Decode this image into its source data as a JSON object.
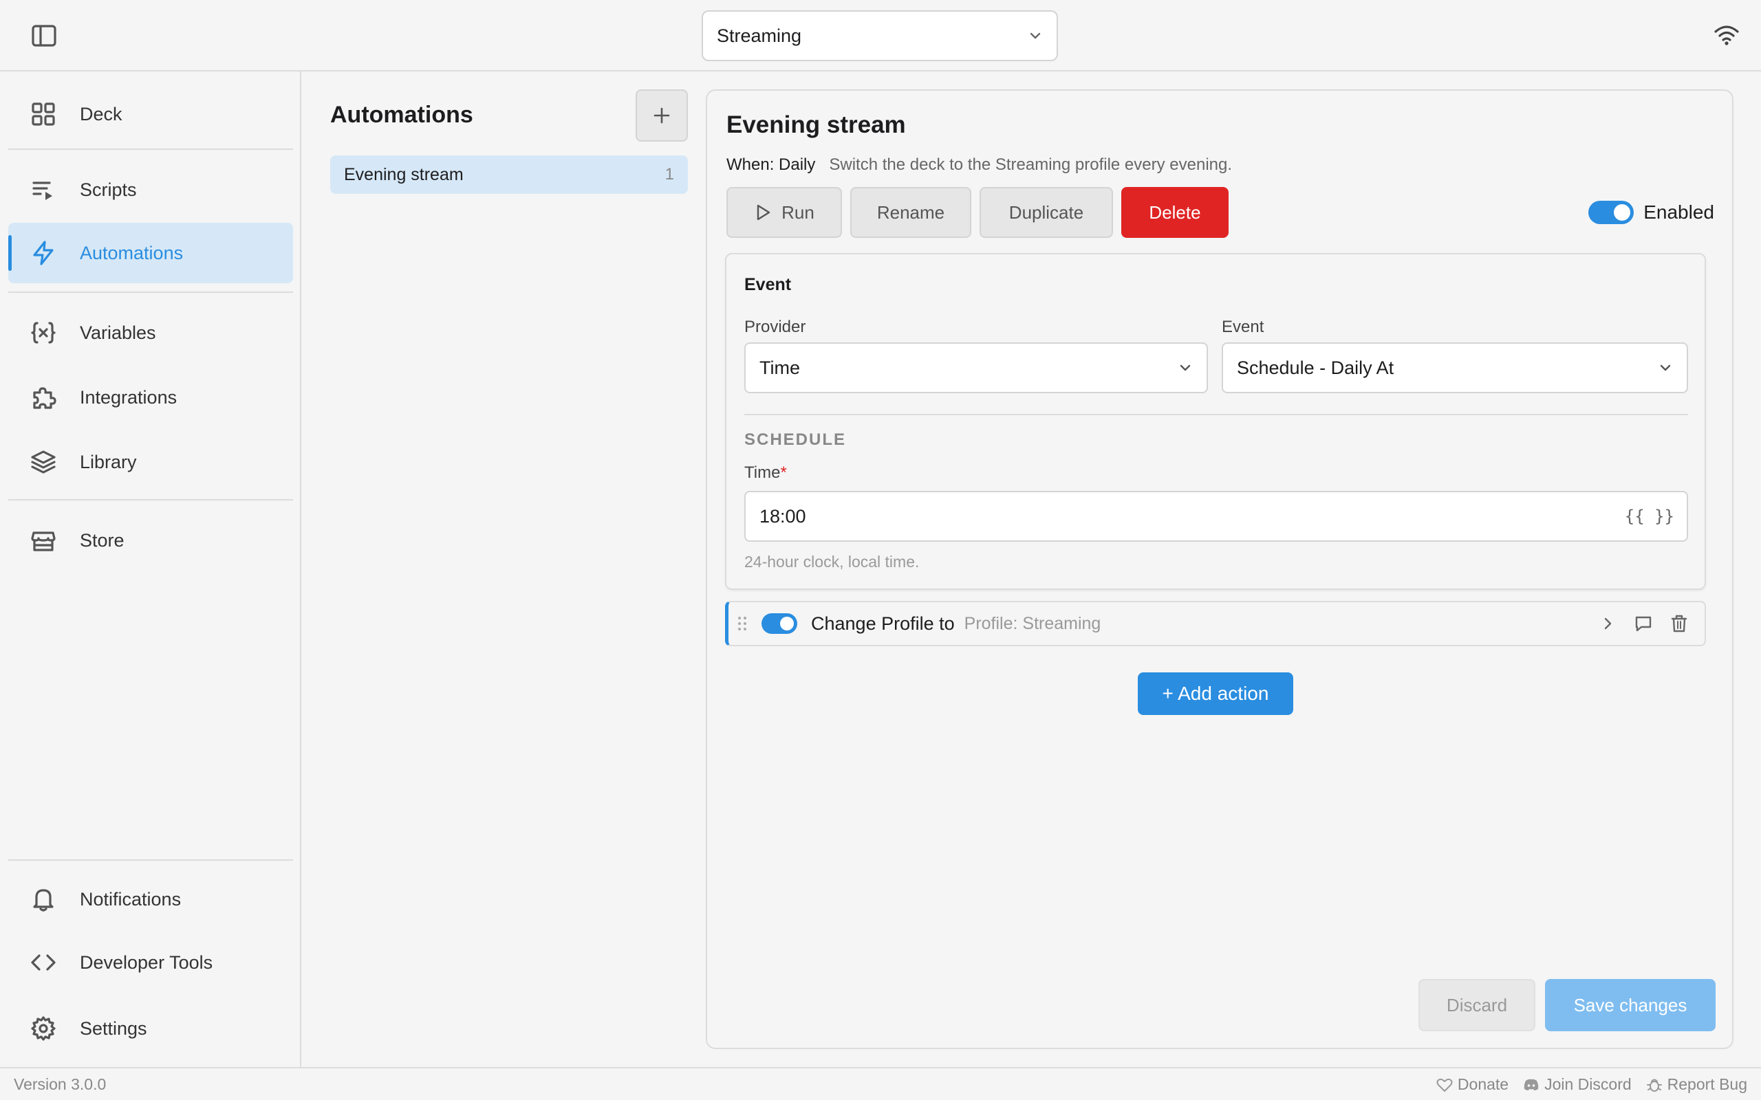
{
  "header": {
    "profile_selected": "Streaming",
    "sidebar_toggle_icon": "sidebar-toggle-icon",
    "status_icon": "wifi-icon"
  },
  "sidebar": {
    "items": [
      {
        "label": "Deck",
        "icon": "grid-icon"
      },
      {
        "label": "Scripts",
        "icon": "script-list-icon"
      },
      {
        "label": "Automations",
        "icon": "lightning-icon",
        "active": true
      },
      {
        "label": "Variables",
        "icon": "variable-icon"
      },
      {
        "label": "Integrations",
        "icon": "puzzle-icon"
      },
      {
        "label": "Library",
        "icon": "layers-icon"
      },
      {
        "label": "Store",
        "icon": "store-icon"
      }
    ],
    "bottom_items": [
      {
        "label": "Notifications",
        "icon": "bell-icon"
      },
      {
        "label": "Developer Tools",
        "icon": "code-icon"
      },
      {
        "label": "Settings",
        "icon": "gear-icon"
      }
    ]
  },
  "automations": {
    "title": "Automations",
    "items": [
      {
        "name": "Evening stream",
        "count": "1"
      }
    ]
  },
  "detail": {
    "title": "Evening stream",
    "when_label": "When: Daily",
    "description": "Switch the deck to the Streaming profile every evening.",
    "buttons": {
      "run": "Run",
      "rename": "Rename",
      "duplicate": "Duplicate",
      "delete": "Delete"
    },
    "enabled_label": "Enabled",
    "enabled": true,
    "event": {
      "title": "Event",
      "provider_label": "Provider",
      "provider_value": "Time",
      "event_label": "Event",
      "event_value": "Schedule - Daily At",
      "schedule_heading": "SCHEDULE",
      "time_label": "Time",
      "required_mark": "*",
      "time_value": "18:00",
      "template_token": "{{ }}",
      "time_hint": "24-hour clock, local time."
    },
    "action": {
      "name": "Change Profile to",
      "param": "Profile: Streaming",
      "enabled": true
    },
    "add_action": "+ Add action",
    "discard": "Discard",
    "save": "Save changes"
  },
  "footer": {
    "version": "Version 3.0.0",
    "donate": "Donate",
    "discord": "Join Discord",
    "report": "Report Bug"
  },
  "colors": {
    "accent": "#2a8de0",
    "danger": "#e02424",
    "active_bg": "#d6e8f7",
    "save_disabled": "#7fbdf0"
  }
}
